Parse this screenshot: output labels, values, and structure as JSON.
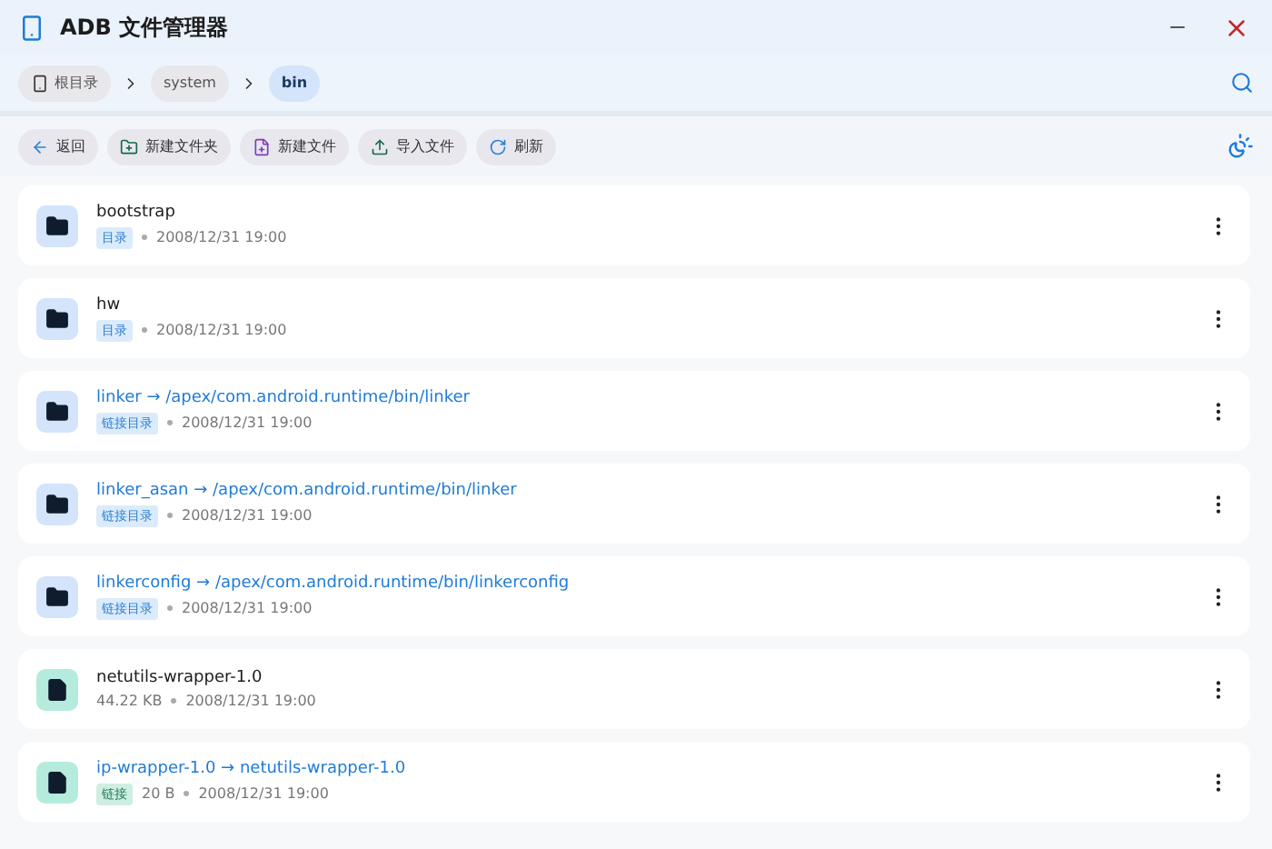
{
  "window": {
    "title": "ADB 文件管理器"
  },
  "breadcrumb": [
    {
      "label": "根目录",
      "kind": "root",
      "selected": false
    },
    {
      "label": "system",
      "kind": "dir",
      "selected": false
    },
    {
      "label": "bin",
      "kind": "dir",
      "selected": true
    }
  ],
  "toolbar": [
    {
      "label": "返回",
      "kind": "back"
    },
    {
      "label": "新建文件夹",
      "kind": "folder"
    },
    {
      "label": "新建文件",
      "kind": "file"
    },
    {
      "label": "导入文件",
      "kind": "upload"
    },
    {
      "label": "刷新",
      "kind": "refresh"
    }
  ],
  "files": [
    {
      "name": "bootstrap",
      "kind": "folder",
      "link": false,
      "tag": "目录",
      "date": "2008/12/31 19:00"
    },
    {
      "name": "hw",
      "kind": "folder",
      "link": false,
      "tag": "目录",
      "date": "2008/12/31 19:00"
    },
    {
      "name": "linker → /apex/com.android.runtime/bin/linker",
      "kind": "folder",
      "link": true,
      "tag": "链接目录",
      "date": "2008/12/31 19:00"
    },
    {
      "name": "linker_asan → /apex/com.android.runtime/bin/linker",
      "kind": "folder",
      "link": true,
      "tag": "链接目录",
      "date": "2008/12/31 19:00"
    },
    {
      "name": "linkerconfig → /apex/com.android.runtime/bin/linkerconfig",
      "kind": "folder",
      "link": true,
      "tag": "链接目录",
      "date": "2008/12/31 19:00"
    },
    {
      "name": "netutils-wrapper-1.0",
      "kind": "file",
      "link": false,
      "size": "44.22 KB",
      "date": "2008/12/31 19:00"
    },
    {
      "name": "ip-wrapper-1.0 → netutils-wrapper-1.0",
      "kind": "file",
      "link": true,
      "tag": "链接",
      "size": "20 B",
      "date": "2008/12/31 19:00"
    }
  ]
}
